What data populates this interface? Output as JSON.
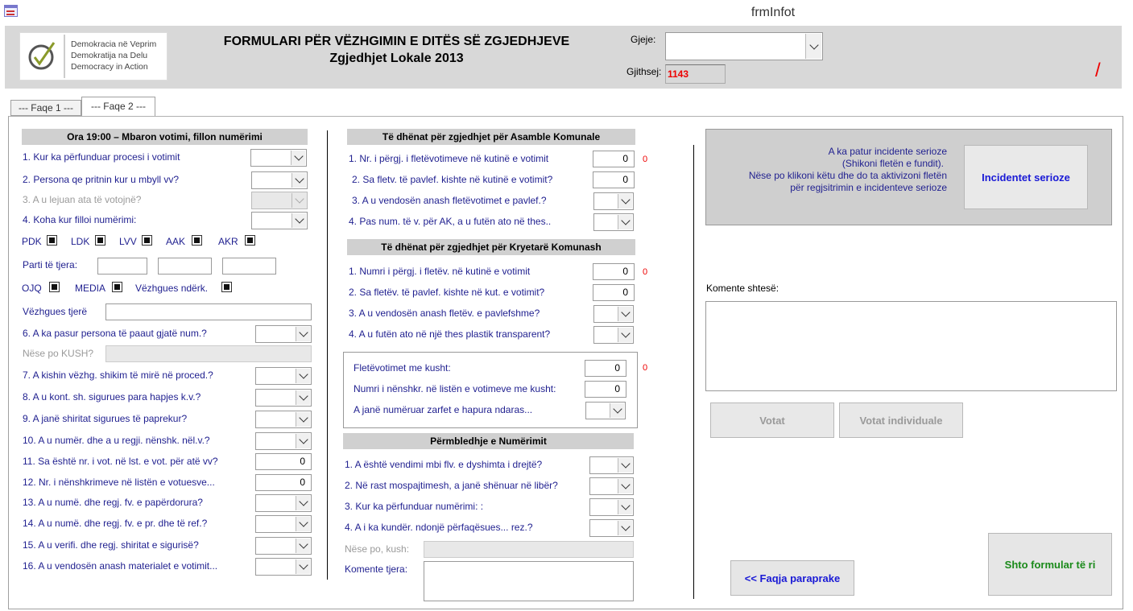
{
  "window": {
    "title": "frmInfot"
  },
  "logo": {
    "line1": "Demokracia në Veprim",
    "line2": "Demokratija na Delu",
    "line3": "Democracy in Action"
  },
  "header": {
    "title": "FORMULARI PËR VËZHGIMIN E DITËS SË ZGJEDHJEVE",
    "subtitle": "Zgjedhjet Lokale 2013",
    "gjeje_label": "Gjeje:",
    "gjithsej_label": "Gjithsej:",
    "gjithsej_value": "1143",
    "slash": "/"
  },
  "tabs": [
    "--- Faqe 1 ---",
    "--- Faqe 2 ---"
  ],
  "col1": {
    "header": "Ora 19:00 – Mbaron votimi, fillon numërimi",
    "q1": "1. Kur ka përfunduar procesi i votimit",
    "q2": "2. Persona qe pritnin kur u mbyll vv?",
    "q3": "3. A u lejuan ata të votojnë?",
    "q4": "4. Koha kur filloi numërimi:",
    "parties": [
      "PDK",
      "LDK",
      "LVV",
      "AAK",
      "AKR"
    ],
    "other_parties": "Parti të tjera:",
    "ojq": "OJQ",
    "media": "MEDIA",
    "intl": "Vëzhgues ndërk.",
    "other_obs": "Vëzhgues tjerë",
    "q6": "6. A ka pasur persona të paaut gjatë num.?",
    "q6who": "Nëse po KUSH?",
    "q7": "7. A kishin vëzhg. shikim të mirë në proced.?",
    "q8": "8. A u kont. sh. sigurues para hapjes k.v.?",
    "q9": "9. A janë shiritat sigurues të paprekur?",
    "q10": "10. A u numër. dhe a u regji. nënshk. nël.v.?",
    "q11": "11. Sa është nr. i vot. në lst. e vot. për atë vv?",
    "q11_val": "0",
    "q12": "12. Nr. i nënshkrimeve në listën e votuesve...",
    "q12_val": "0",
    "q13": "13. A u numë. dhe regj. fv. e papërdorura?",
    "q14": "14. A u numë. dhe regj. fv. e pr. dhe të ref.?",
    "q15": "15. A u verifi. dhe regj. shiritat e sigurisë?",
    "q16": "16. A u vendosën anash materialet e votimit..."
  },
  "col2": {
    "ak_header": "Të dhënat për zgjedhjet për Asamble Komunale",
    "ak1": "1. Nr. i përgj. i fletëvotimeve në kutinë e votimit",
    "ak1_val": "0",
    "ak2": "2. Sa fletv. të pavlef. kishte në kutinë e votimit?",
    "ak2_val": "0",
    "ak3": "3. A u vendosën anash fletëvotimet e pavlef.?",
    "ak4": "4. Pas num. të v. për AK, a u futën ato në thes..",
    "kk_header": "Të dhënat për zgjedhjet për Kryetarë Komunash",
    "kk1": "1. Numri i përgj. i fletëv. në kutinë e votimit",
    "kk1_val": "0",
    "kk2": "2. Sa fletëv. të pavlef. kishte në kut. e votimit?",
    "kk2_val": "0",
    "kk3": "3. A u vendosën anash fletëv. e pavlefshme?",
    "kk4": "4. A u futën ato në një thes plastik transparent?",
    "kusht1": "Fletëvotimet me kusht:",
    "kusht1_val": "0",
    "kusht2": "Numri i nënshkr. në listën e votimeve me kusht:",
    "kusht2_val": "0",
    "kusht3": "A janë numëruar zarfet e hapura ndaras...",
    "sum_header": "Përmbledhje e Numërimit",
    "s1": "1. A është vendimi mbi flv. e dyshimta i drejtë?",
    "s2": "2. Në rast mospajtimesh, a janë shënuar në libër?",
    "s3": "3. Kur ka përfunduar numërimi: :",
    "s4": "4. A i ka kundër. ndonjë përfaqësues... rez.?",
    "s_who": "Nëse po, kush:",
    "s_comments": "Komente tjera:",
    "red_zero": "0"
  },
  "col3": {
    "incident_text1": "A ka patur incidente serioze",
    "incident_text2": "(Shikoni fletën e fundit).",
    "incident_text3": "Nëse po klikoni këtu dhe do ta aktivizoni fletën",
    "incident_text4": "për regjsitrimin e  incidenteve serioze",
    "incident_button": "Incidentet serioze",
    "comments_label": "Komente shtesë:",
    "votat": "Votat",
    "votat_ind": "Votat individuale",
    "prev": "<< Faqja paraprake",
    "new": "Shto formular të ri"
  },
  "colors": {
    "accent_blue": "#1a1ad6",
    "green": "#1a8a1a",
    "red": "#e00000"
  }
}
